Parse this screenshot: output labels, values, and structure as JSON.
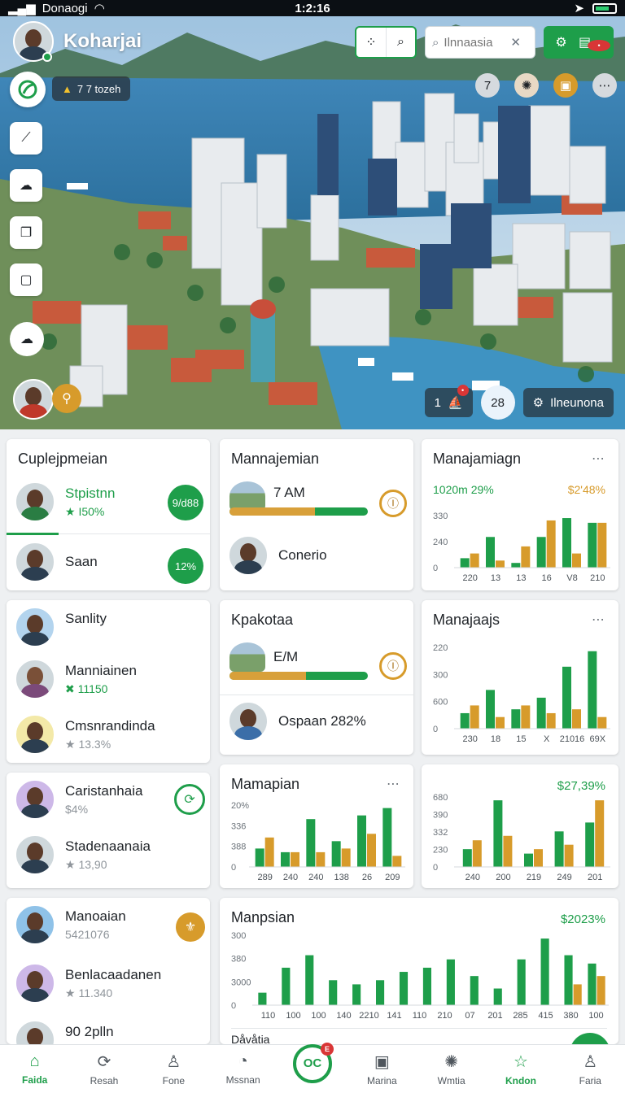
{
  "status_bar": {
    "carrier": "Donaogi",
    "time": "1:2:16"
  },
  "hero": {
    "title": "Koharjai",
    "alert_text": "7 7 tozeh",
    "search_placeholder": "Ilnnaasia",
    "round_count": "7",
    "ctrl_count": "1",
    "ctrl_round_value": "28",
    "ctrl_label": "Ilneunona"
  },
  "colors": {
    "primary": "#1e9e4a",
    "accent": "#d79b2b",
    "alert": "#d93636"
  },
  "cards": {
    "c1": {
      "title": "Cuplejpmeian",
      "row1": {
        "name": "Stpistnn",
        "sub": "★ I50%",
        "badge": "9/d88"
      },
      "row2": {
        "name": "Saan",
        "badge": "12%"
      }
    },
    "c2": {
      "title": "Mannajemian",
      "time": "7 AM",
      "progress": 0.62,
      "row_name": "Conerio"
    },
    "c3": {
      "title": "Manajamiagn",
      "left_value": "1020m 29%",
      "right_value": "$2'48%"
    },
    "c4": {
      "row1": {
        "name": "Sanlity"
      },
      "row2": {
        "name": "Manniainen",
        "sub": "✖ 11150"
      },
      "row3": {
        "name": "Cmsnrandinda",
        "sub": "★ 13.3%"
      }
    },
    "c5": {
      "title": "Kpakotaa",
      "time": "E/M",
      "progress": 0.55,
      "row_name": "Ospaan 282%"
    },
    "c6": {
      "title": "Manajaajs"
    },
    "c7": {
      "row1": {
        "name": "Caristanhaia",
        "sub": "$4%"
      },
      "row2": {
        "name": "Stadenaanaia",
        "sub": "★ 13,90"
      }
    },
    "c8": {
      "title": "Mamapian"
    },
    "c9": {
      "right_value": "$27,39%"
    },
    "c10": {
      "row1": {
        "name": "Manoaian",
        "sub": "5421076"
      },
      "row2": {
        "name": "Benlacaadanen",
        "sub": "★ 11.340"
      },
      "row3": {
        "name": "90 2plln"
      }
    },
    "c11": {
      "title": "Manpsian",
      "right_value": "$2023%",
      "footer_label": "Dåvåtia"
    }
  },
  "chart_data": [
    {
      "type": "bar",
      "title": "Manajamiagn",
      "categories": [
        "220",
        "13",
        "13",
        "16",
        "V8",
        "210"
      ],
      "series": [
        {
          "color": "#1e9e4a",
          "values": [
            40,
            130,
            20,
            130,
            210,
            190
          ]
        },
        {
          "color": "#d79b2b",
          "values": [
            60,
            30,
            90,
            200,
            60,
            190
          ]
        }
      ],
      "y_ticks": [
        "330",
        "240",
        "0"
      ]
    },
    {
      "type": "bar",
      "title": "Manajaajs",
      "categories": [
        "230",
        "18",
        "15",
        "X",
        "21016",
        "69X"
      ],
      "series": [
        {
          "color": "#1e9e4a",
          "values": [
            40,
            100,
            50,
            80,
            160,
            200
          ]
        },
        {
          "color": "#d79b2b",
          "values": [
            60,
            30,
            60,
            40,
            50,
            30
          ]
        }
      ],
      "y_ticks": [
        "220",
        "300",
        "600",
        "0"
      ]
    },
    {
      "type": "bar",
      "title": "Mamapian",
      "categories": [
        "289",
        "240",
        "240",
        "138",
        "26",
        "209"
      ],
      "series": [
        {
          "color": "#1e9e4a",
          "values": [
            50,
            40,
            130,
            70,
            140,
            160
          ]
        },
        {
          "color": "#d79b2b",
          "values": [
            80,
            40,
            40,
            50,
            90,
            30
          ]
        }
      ],
      "y_ticks": [
        "20%",
        "336",
        "388",
        "0"
      ]
    },
    {
      "type": "bar",
      "categories": [
        "240",
        "200",
        "219",
        "249",
        "201"
      ],
      "series": [
        {
          "color": "#1e9e4a",
          "values": [
            40,
            150,
            30,
            80,
            100
          ]
        },
        {
          "color": "#d79b2b",
          "values": [
            60,
            70,
            40,
            50,
            150
          ]
        }
      ],
      "y_ticks": [
        "680",
        "390",
        "332",
        "230",
        "0"
      ]
    },
    {
      "type": "bar",
      "title": "Manpsian",
      "categories": [
        "110",
        "100",
        "100",
        "140",
        "2210",
        "141",
        "110",
        "210",
        "07",
        "201",
        "285",
        "415",
        "380",
        "100"
      ],
      "series": [
        {
          "color": "#1e9e4a",
          "values": [
            30,
            90,
            120,
            60,
            50,
            60,
            80,
            90,
            110,
            70,
            40,
            110,
            160,
            120,
            100
          ]
        },
        {
          "color": "#d79b2b",
          "values": [
            0,
            0,
            0,
            0,
            0,
            0,
            0,
            0,
            0,
            0,
            0,
            0,
            0,
            50,
            70
          ]
        }
      ],
      "y_ticks": [
        "300",
        "380",
        "3000",
        "0"
      ]
    }
  ],
  "nav": [
    "Faida",
    "Resah",
    "Fone",
    "Mssnan",
    "OC",
    "Wmtia",
    "Kndon",
    "Faria"
  ]
}
